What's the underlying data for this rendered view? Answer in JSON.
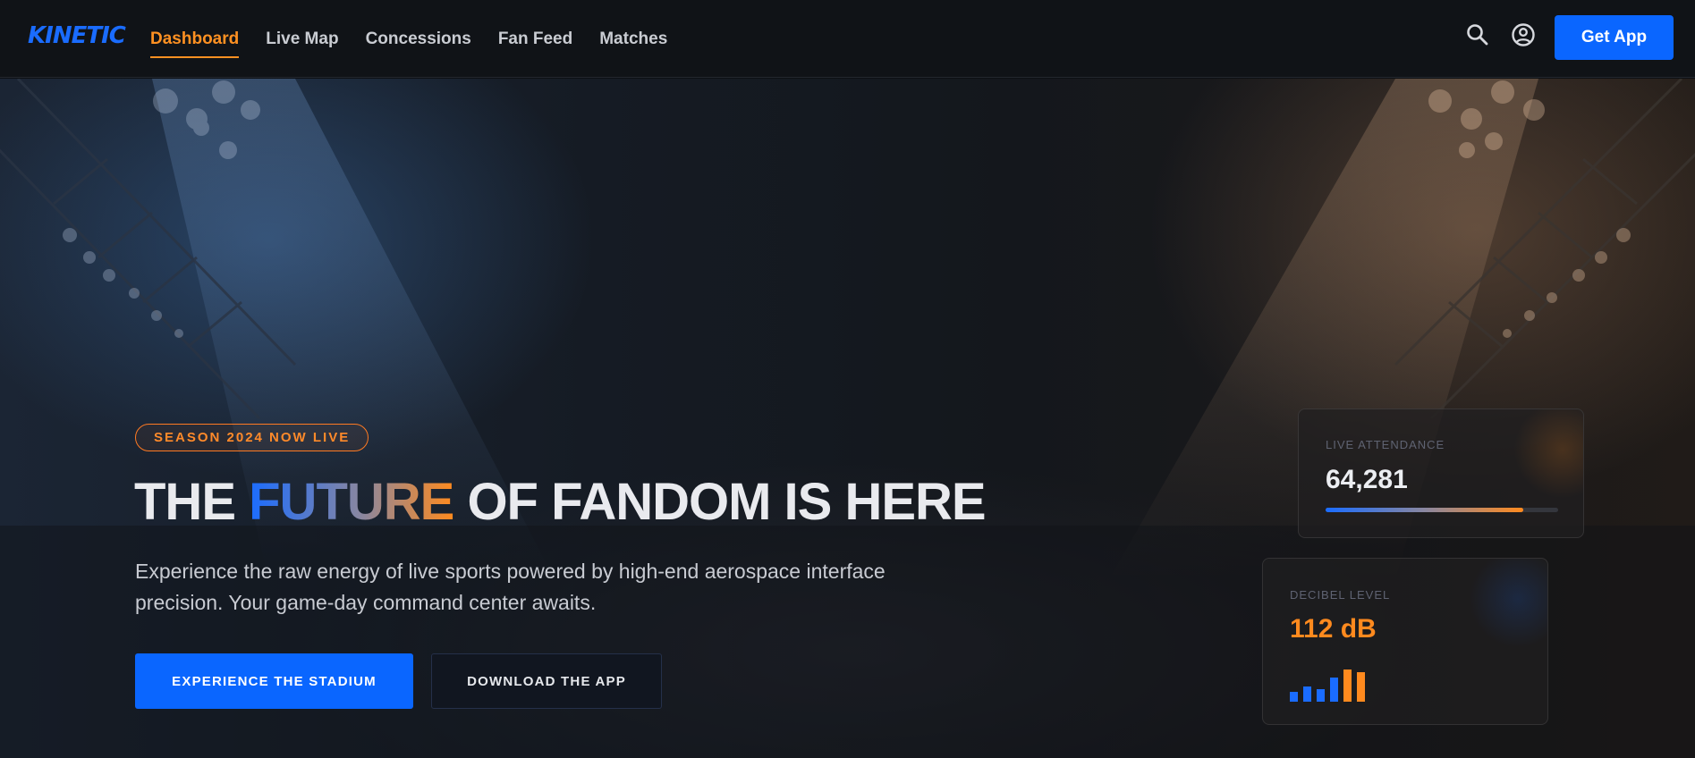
{
  "brand": {
    "logo": "KINETIC",
    "logo_color": "#1a6cff"
  },
  "nav": {
    "items": [
      {
        "label": "Dashboard",
        "active": true
      },
      {
        "label": "Live Map",
        "active": false
      },
      {
        "label": "Concessions",
        "active": false
      },
      {
        "label": "Fan Feed",
        "active": false
      },
      {
        "label": "Matches",
        "active": false
      }
    ],
    "icons": [
      "search-icon",
      "account-icon"
    ],
    "cta_label": "Get App"
  },
  "hero": {
    "badge": "SEASON 2024 NOW LIVE",
    "headline": {
      "before": "THE ",
      "highlight": "FUTURE",
      "after": " OF FANDOM IS HERE"
    },
    "subtext": "Experience the raw energy of live sports powered by high-end aerospace interface precision. Your game-day command center awaits.",
    "primary_button": "EXPERIENCE THE STADIUM",
    "secondary_button": "DOWNLOAD THE APP"
  },
  "stats": {
    "attendance": {
      "label": "LIVE ATTENDANCE",
      "value": "64,281",
      "progress": 0.85
    },
    "decibel": {
      "label": "DECIBEL LEVEL",
      "value": "112 dB",
      "levels": [
        0.25,
        0.4,
        0.33,
        0.65,
        0.85,
        0.78
      ],
      "bar_colors": [
        "#1a6cff",
        "#1a6cff",
        "#1a6cff",
        "#1a6cff",
        "#ff8a1e",
        "#ff8a1e"
      ]
    }
  },
  "colors": {
    "accent_orange": "#ff9122",
    "accent_blue": "#0a66ff",
    "background": "#0d1014"
  }
}
